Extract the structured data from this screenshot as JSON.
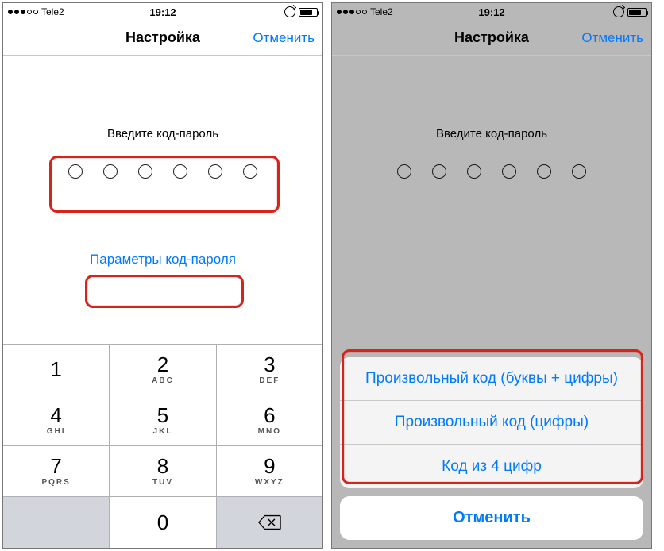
{
  "status": {
    "carrier": "Tele2",
    "time": "19:12"
  },
  "nav": {
    "title": "Настройка",
    "cancel": "Отменить"
  },
  "passcode": {
    "prompt": "Введите код-пароль",
    "options_link": "Параметры код-пароля"
  },
  "keypad": {
    "k1": {
      "num": "1",
      "let": ""
    },
    "k2": {
      "num": "2",
      "let": "ABC"
    },
    "k3": {
      "num": "3",
      "let": "DEF"
    },
    "k4": {
      "num": "4",
      "let": "GHI"
    },
    "k5": {
      "num": "5",
      "let": "JKL"
    },
    "k6": {
      "num": "6",
      "let": "MNO"
    },
    "k7": {
      "num": "7",
      "let": "PQRS"
    },
    "k8": {
      "num": "8",
      "let": "TUV"
    },
    "k9": {
      "num": "9",
      "let": "WXYZ"
    },
    "k0": {
      "num": "0",
      "let": ""
    }
  },
  "sheet": {
    "opt1": "Произвольный код (буквы + цифры)",
    "opt2": "Произвольный код (цифры)",
    "opt3": "Код из 4 цифр",
    "cancel": "Отменить"
  }
}
